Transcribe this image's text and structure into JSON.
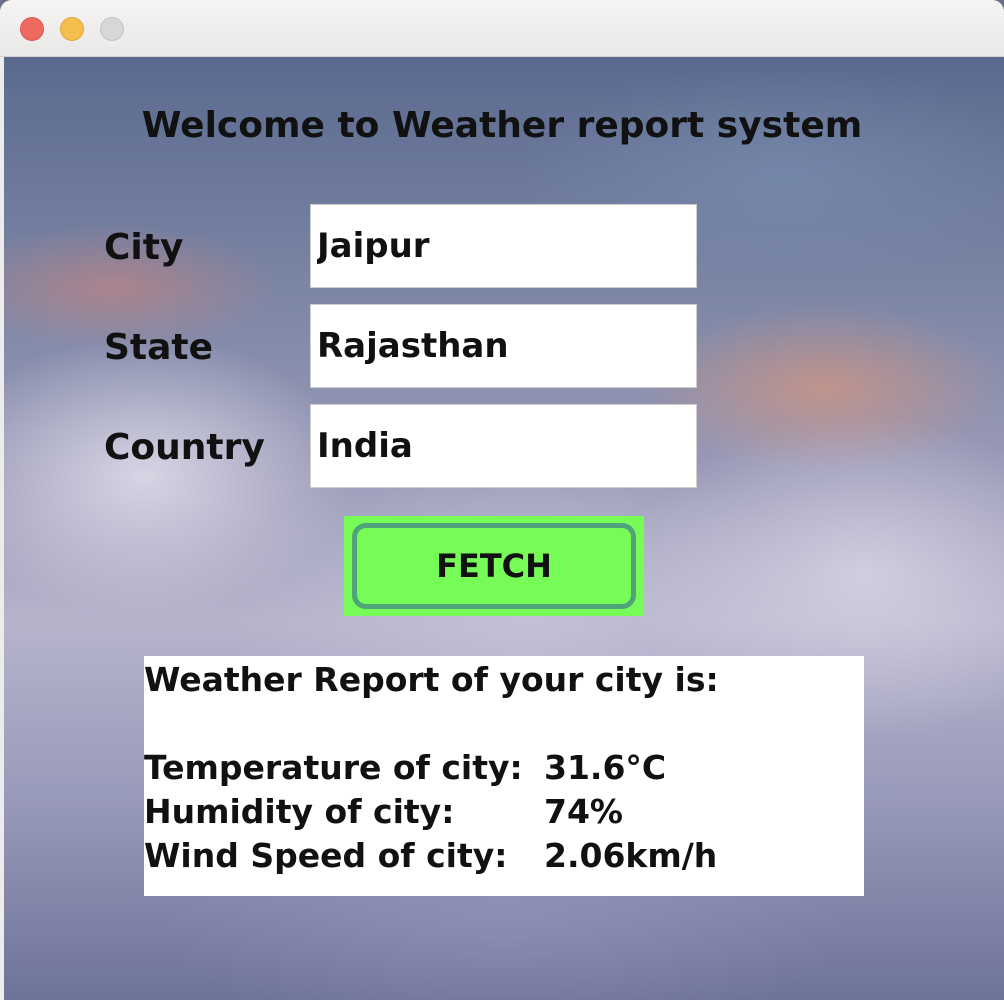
{
  "window": {
    "traffic_lights": [
      "close",
      "minimize",
      "maximize"
    ]
  },
  "header": {
    "title": "Welcome to Weather report system"
  },
  "form": {
    "city_label": "City",
    "city_value": "Jaipur",
    "state_label": "State",
    "state_value": "Rajasthan",
    "country_label": "Country",
    "country_value": "India",
    "fetch_label": "FETCH"
  },
  "report": {
    "heading": "Weather Report of your city is:",
    "temperature_label": "Temperature of city:",
    "temperature_value": "31.6°C",
    "humidity_label": "Humidity of city:",
    "humidity_value": "74%",
    "wind_label": "Wind Speed of city:",
    "wind_value": "2.06km/h"
  },
  "colors": {
    "fetch_bg": "#77fb57",
    "fetch_border": "#4ea37a",
    "close": "#ee6a5f",
    "minimize": "#f5be4f",
    "maximize": "#d9d7d5"
  }
}
